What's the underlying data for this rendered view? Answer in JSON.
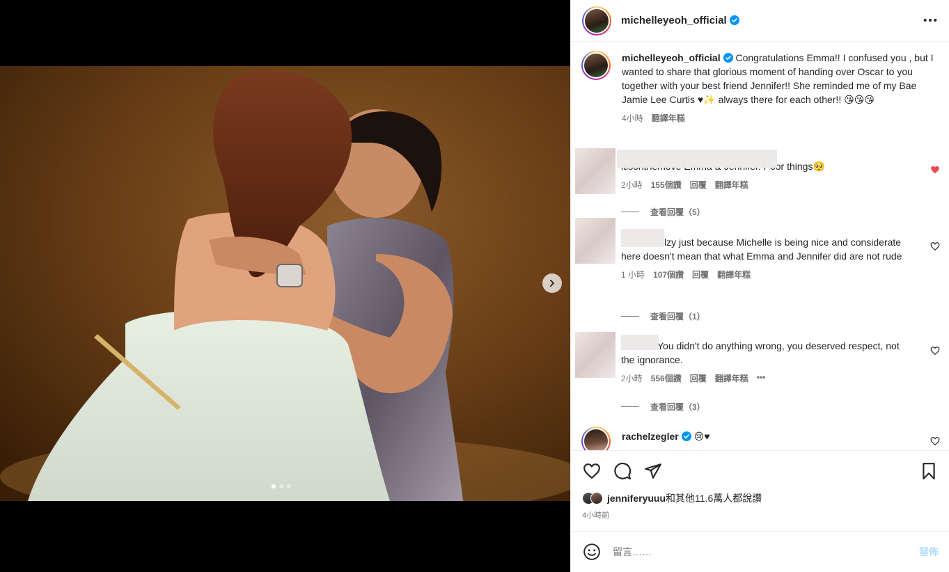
{
  "post": {
    "username": "michelleyeoh_official",
    "more_icon": "more-horizontal-icon"
  },
  "caption": {
    "username": "michelleyeoh_official",
    "text": " Congratulations Emma!! I confused you , but I wanted to share that glorious moment of handing over Oscar to you together with your best friend Jennifer!! She reminded me of my Bae Jamie Lee Curtis ♥✨ always there for each other!! 😘😘😘",
    "time": "4小時",
    "translate": "翻譯年糕"
  },
  "comments": [
    {
      "text": "itisonthemove Emma & Jennifer. Poor things🥺",
      "time": "2小時",
      "likes": "155個讚",
      "reply": "回覆",
      "translate": "翻譯年糕",
      "liked": true,
      "view_replies": "查看回覆（5）"
    },
    {
      "text": "lzy just because Michelle is being nice and considerate here doesn't mean that what Emma and Jennifer did are not rude",
      "time": "1 小時",
      "likes": "107個讚",
      "reply": "回覆",
      "translate": "翻譯年糕",
      "liked": false,
      "view_replies": "查看回覆（1）"
    },
    {
      "text": "You didn't do anything wrong, you deserved respect, not the ignorance.",
      "time": "2小時",
      "likes": "556個讚",
      "reply": "回覆",
      "translate": "翻譯年糕",
      "more": "•••",
      "liked": false,
      "view_replies": "查看回覆（3）"
    }
  ],
  "rz_comment": {
    "username": "rachelzegler",
    "text": " 😢♥"
  },
  "likes_line": {
    "user": "jenniferyuuu",
    "rest": "和其他11.6萬人都說讚"
  },
  "posted_ago": "4小時前",
  "composer": {
    "placeholder": "留言……",
    "post_label": "發佈"
  },
  "colors": {
    "liked_heart": "#ed4956",
    "verified": "#0095f6",
    "post_disabled": "#b3dbff"
  },
  "carousel": {
    "count": 3,
    "active": 0
  }
}
